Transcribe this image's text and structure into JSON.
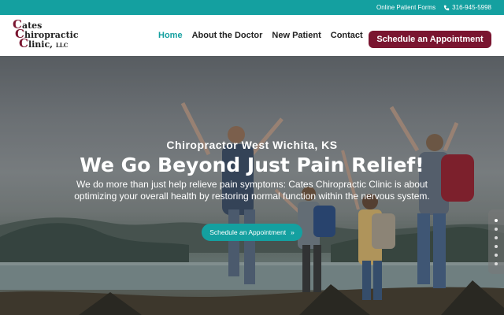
{
  "topbar": {
    "forms_label": "Online Patient Forms",
    "phone": "316-945-5998",
    "bg_color": "#14a0a0"
  },
  "logo": {
    "line1": "Cates",
    "line2": "Chiropractic",
    "line3": "Clinic,",
    "line3_suffix": "LLC"
  },
  "nav": {
    "items": [
      {
        "label": "Home",
        "active": true
      },
      {
        "label": "About the Doctor",
        "active": false
      },
      {
        "label": "New Patient",
        "active": false
      },
      {
        "label": "Contact",
        "active": false
      }
    ],
    "cta_label": "Schedule an Appointment",
    "cta_color": "#7a1530"
  },
  "hero": {
    "subtitle": "Chiropractor West Wichita, KS",
    "title": "We Go Beyond Just Pain Relief!",
    "description": "We do more than just help relieve pain symptoms: Cates Chiropractic Clinic is about optimizing your overall health by restoring normal function within the nervous system.",
    "button_label": "Schedule an Appointment",
    "button_icon": "double-chevron-right-icon"
  },
  "slider": {
    "dot_count": 6,
    "active_index": 0
  }
}
